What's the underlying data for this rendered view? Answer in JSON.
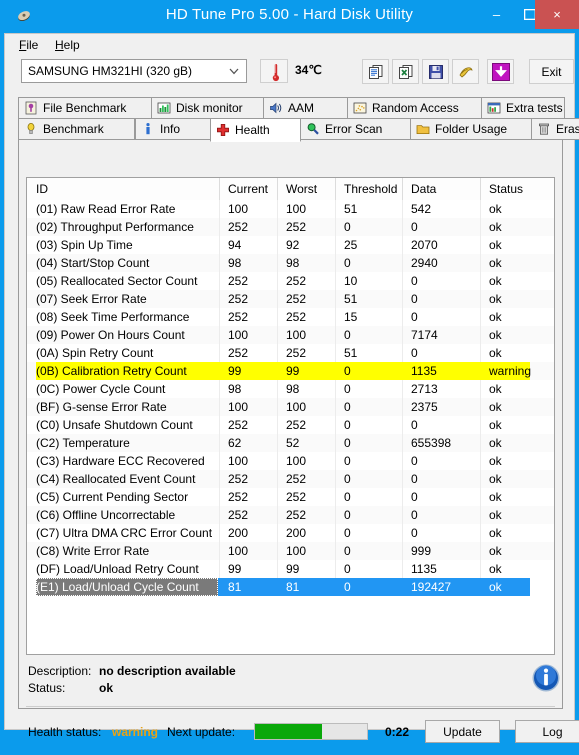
{
  "window": {
    "title": "HD Tune Pro 5.00 - Hard Disk Utility",
    "icon": "hard-disk-icon",
    "minimize": "–",
    "maximize": "☐",
    "close": "×"
  },
  "menu": {
    "items": [
      {
        "label": "File",
        "mnemonic": "F"
      },
      {
        "label": "Help",
        "mnemonic": "H"
      }
    ]
  },
  "toolbar": {
    "drive_select": {
      "value": "SAMSUNG HM321HI (320 gB)",
      "arrow": "⌄"
    },
    "temperature": {
      "icon": "thermometer-icon",
      "value": "34℃"
    },
    "buttons": [
      {
        "name": "copy-icon",
        "title": ""
      },
      {
        "name": "copy-excel-icon",
        "title": ""
      },
      {
        "name": "save-icon",
        "title": ""
      },
      {
        "name": "settings-icon",
        "title": ""
      },
      {
        "name": "download-icon",
        "title": ""
      }
    ],
    "exit_label": "Exit"
  },
  "tabs": {
    "row1": [
      {
        "label": "File Benchmark",
        "icon": "file-benchmark-icon",
        "active": false
      },
      {
        "label": "Disk monitor",
        "icon": "disk-monitor-icon",
        "active": false
      },
      {
        "label": "AAM",
        "icon": "aam-speaker-icon",
        "active": false
      },
      {
        "label": "Random Access",
        "icon": "random-access-icon",
        "active": false
      },
      {
        "label": "Extra tests",
        "icon": "extra-tests-icon",
        "active": false
      }
    ],
    "row2": [
      {
        "label": "Benchmark",
        "icon": "benchmark-icon",
        "active": false
      },
      {
        "label": "Info",
        "icon": "info-icon",
        "active": false
      },
      {
        "label": "Health",
        "icon": "health-cross-icon",
        "active": true
      },
      {
        "label": "Error Scan",
        "icon": "error-scan-icon",
        "active": false
      },
      {
        "label": "Folder Usage",
        "icon": "folder-icon",
        "active": false
      },
      {
        "label": "Erase",
        "icon": "trash-icon",
        "active": false
      }
    ]
  },
  "table": {
    "columns": [
      "ID",
      "Current",
      "Worst",
      "Threshold",
      "Data",
      "Status"
    ],
    "rows": [
      {
        "id": "(01) Raw Read Error Rate",
        "current": "100",
        "worst": "100",
        "threshold": "51",
        "data": "542",
        "status": "ok",
        "state": "normal"
      },
      {
        "id": "(02) Throughput Performance",
        "current": "252",
        "worst": "252",
        "threshold": "0",
        "data": "0",
        "status": "ok",
        "state": "normal"
      },
      {
        "id": "(03) Spin Up Time",
        "current": "94",
        "worst": "92",
        "threshold": "25",
        "data": "2070",
        "status": "ok",
        "state": "normal"
      },
      {
        "id": "(04) Start/Stop Count",
        "current": "98",
        "worst": "98",
        "threshold": "0",
        "data": "2940",
        "status": "ok",
        "state": "normal"
      },
      {
        "id": "(05) Reallocated Sector Count",
        "current": "252",
        "worst": "252",
        "threshold": "10",
        "data": "0",
        "status": "ok",
        "state": "normal"
      },
      {
        "id": "(07) Seek Error Rate",
        "current": "252",
        "worst": "252",
        "threshold": "51",
        "data": "0",
        "status": "ok",
        "state": "normal"
      },
      {
        "id": "(08) Seek Time Performance",
        "current": "252",
        "worst": "252",
        "threshold": "15",
        "data": "0",
        "status": "ok",
        "state": "normal"
      },
      {
        "id": "(09) Power On Hours Count",
        "current": "100",
        "worst": "100",
        "threshold": "0",
        "data": "7174",
        "status": "ok",
        "state": "normal"
      },
      {
        "id": "(0A) Spin Retry Count",
        "current": "252",
        "worst": "252",
        "threshold": "51",
        "data": "0",
        "status": "ok",
        "state": "normal"
      },
      {
        "id": "(0B) Calibration Retry Count",
        "current": "99",
        "worst": "99",
        "threshold": "0",
        "data": "1135",
        "status": "warning",
        "state": "warn"
      },
      {
        "id": "(0C) Power Cycle Count",
        "current": "98",
        "worst": "98",
        "threshold": "0",
        "data": "2713",
        "status": "ok",
        "state": "normal"
      },
      {
        "id": "(BF) G-sense Error Rate",
        "current": "100",
        "worst": "100",
        "threshold": "0",
        "data": "2375",
        "status": "ok",
        "state": "normal"
      },
      {
        "id": "(C0) Unsafe Shutdown Count",
        "current": "252",
        "worst": "252",
        "threshold": "0",
        "data": "0",
        "status": "ok",
        "state": "normal"
      },
      {
        "id": "(C2) Temperature",
        "current": "62",
        "worst": "52",
        "threshold": "0",
        "data": "655398",
        "status": "ok",
        "state": "normal"
      },
      {
        "id": "(C3) Hardware ECC Recovered",
        "current": "100",
        "worst": "100",
        "threshold": "0",
        "data": "0",
        "status": "ok",
        "state": "normal"
      },
      {
        "id": "(C4) Reallocated Event Count",
        "current": "252",
        "worst": "252",
        "threshold": "0",
        "data": "0",
        "status": "ok",
        "state": "normal"
      },
      {
        "id": "(C5) Current Pending Sector",
        "current": "252",
        "worst": "252",
        "threshold": "0",
        "data": "0",
        "status": "ok",
        "state": "normal"
      },
      {
        "id": "(C6) Offline Uncorrectable",
        "current": "252",
        "worst": "252",
        "threshold": "0",
        "data": "0",
        "status": "ok",
        "state": "normal"
      },
      {
        "id": "(C7) Ultra DMA CRC Error Count",
        "current": "200",
        "worst": "200",
        "threshold": "0",
        "data": "0",
        "status": "ok",
        "state": "normal"
      },
      {
        "id": "(C8) Write Error Rate",
        "current": "100",
        "worst": "100",
        "threshold": "0",
        "data": "999",
        "status": "ok",
        "state": "normal"
      },
      {
        "id": "(DF) Load/Unload Retry Count",
        "current": "99",
        "worst": "99",
        "threshold": "0",
        "data": "1135",
        "status": "ok",
        "state": "normal"
      },
      {
        "id": "(E1) Load/Unload Cycle Count",
        "current": "81",
        "worst": "81",
        "threshold": "0",
        "data": "192427",
        "status": "ok",
        "state": "selected"
      }
    ]
  },
  "details": {
    "description_label": "Description:",
    "description_value": "no description available",
    "status_label": "Status:",
    "status_value": "ok",
    "info_icon": "information-icon"
  },
  "statusbar": {
    "health_label": "Health status:",
    "health_value": "warning",
    "next_update_label": "Next update:",
    "progress_percent": 60,
    "countdown": "0:22",
    "update_label": "Update",
    "log_label": "Log"
  },
  "colors": {
    "titlebar": "#0b9bec",
    "close_button": "#ca5252",
    "warning_row": "#ffff00",
    "selected_row": "#2196f3",
    "warning_text": "#e8a317",
    "progress_fill": "#0aa80a"
  }
}
